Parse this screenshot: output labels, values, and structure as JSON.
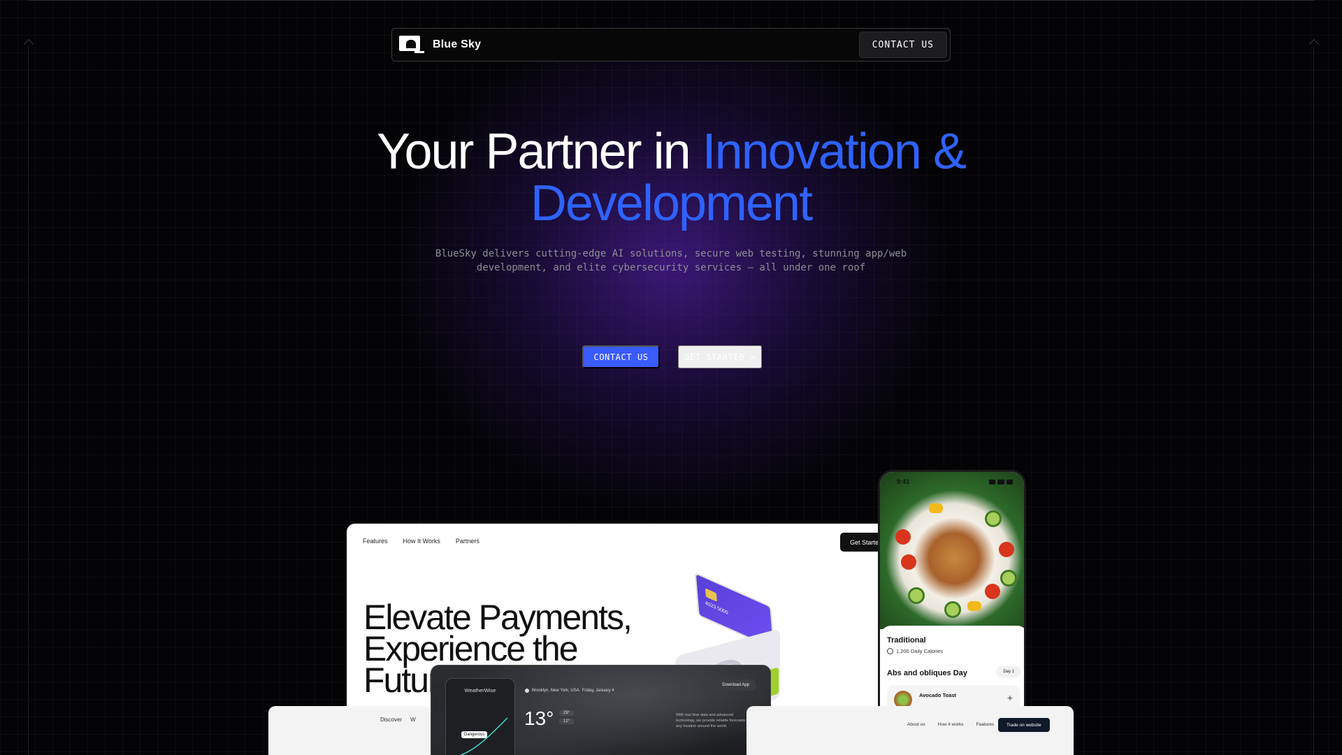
{
  "nav": {
    "brand": "Blue Sky",
    "contact_label": "CONTACT US"
  },
  "hero": {
    "title_line1_white": "Your Partner in ",
    "title_line1_blue": "Innovation &",
    "title_line2_blue": "Development",
    "subtitle": "BlueSky delivers cutting-edge AI solutions, secure web testing, stunning app/web development, and elite cybersecurity services — all under one roof",
    "primary_cta": "CONTACT US",
    "secondary_cta": "GET STARTED >"
  },
  "colors": {
    "accent_blue": "#2f62ff",
    "button_blue": "#3a5bff",
    "background": "#040406",
    "glow_purple": "#6828d2"
  },
  "showcase": {
    "payment": {
      "nav": [
        "Features",
        "How It Works",
        "Partners"
      ],
      "cta": "Get Started",
      "headline": "Elevate Payments, Experience the Future",
      "card_number": "4023 5000"
    },
    "meal": {
      "time": "9:41",
      "title": "Traditional",
      "calories": "1,200 Daily Calories",
      "day_title": "Abs and obliques Day",
      "day_badge": "Day 1",
      "item_name": "Avocado Toast"
    },
    "weather": {
      "brand": "WeatherWise",
      "location": "Brooklyn, New York, USA",
      "date": "Friday, January 4",
      "temperature": "13°",
      "high": "29°",
      "low": "12°",
      "download": "Download App",
      "tag": "Dangerous",
      "description": "With real time data and advanced technology, we provide reliable forecasts for any location around the world."
    },
    "left_mock": {
      "nav": [
        "Discover",
        "W"
      ]
    },
    "right_mock": {
      "nav": [
        "About us",
        "How it works",
        "Features"
      ],
      "cta": "Trade on website"
    }
  }
}
